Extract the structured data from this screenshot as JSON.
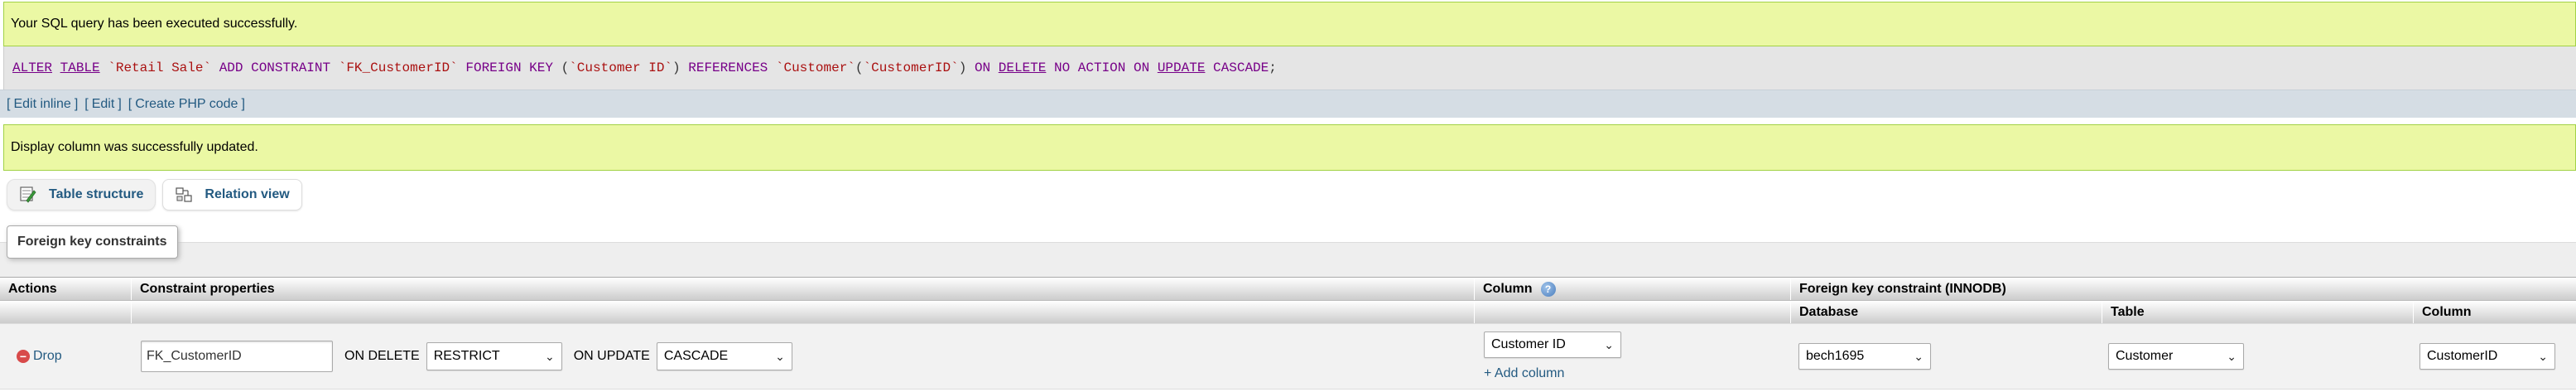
{
  "messages": {
    "query_success": "Your SQL query has been executed successfully.",
    "display_updated": "Display column was successfully updated."
  },
  "sql": {
    "tokens": [
      {
        "t": "ALTER",
        "c": "kw-u"
      },
      {
        "t": " ",
        "c": ""
      },
      {
        "t": "TABLE",
        "c": "kw-u"
      },
      {
        "t": " ",
        "c": ""
      },
      {
        "t": "`Retail Sale`",
        "c": "str"
      },
      {
        "t": " ",
        "c": ""
      },
      {
        "t": "ADD CONSTRAINT",
        "c": "kw"
      },
      {
        "t": " ",
        "c": ""
      },
      {
        "t": "`FK_CustomerID`",
        "c": "str"
      },
      {
        "t": " ",
        "c": ""
      },
      {
        "t": "FOREIGN KEY",
        "c": "kw"
      },
      {
        "t": " ",
        "c": ""
      },
      {
        "t": "(",
        "c": "punc"
      },
      {
        "t": "`Customer ID`",
        "c": "str"
      },
      {
        "t": ")",
        "c": "punc"
      },
      {
        "t": " ",
        "c": ""
      },
      {
        "t": "REFERENCES",
        "c": "kw"
      },
      {
        "t": " ",
        "c": ""
      },
      {
        "t": "`Customer`",
        "c": "str"
      },
      {
        "t": "(",
        "c": "punc"
      },
      {
        "t": "`CustomerID`",
        "c": "str"
      },
      {
        "t": ")",
        "c": "punc"
      },
      {
        "t": " ",
        "c": ""
      },
      {
        "t": "ON",
        "c": "kw"
      },
      {
        "t": " ",
        "c": ""
      },
      {
        "t": "DELETE",
        "c": "kw-u"
      },
      {
        "t": " ",
        "c": ""
      },
      {
        "t": "NO ACTION",
        "c": "kw"
      },
      {
        "t": " ",
        "c": ""
      },
      {
        "t": "ON",
        "c": "kw"
      },
      {
        "t": " ",
        "c": ""
      },
      {
        "t": "UPDATE",
        "c": "kw-u"
      },
      {
        "t": " ",
        "c": ""
      },
      {
        "t": "CASCADE",
        "c": "kw"
      },
      {
        "t": ";",
        "c": "punc"
      }
    ]
  },
  "links": {
    "edit_inline": "Edit inline",
    "edit": "Edit",
    "create_php": "Create PHP code",
    "open_bracket": "[",
    "close_bracket": "]"
  },
  "tabs": {
    "structure": "Table structure",
    "relation": "Relation view"
  },
  "fieldset": {
    "legend": "Foreign key constraints"
  },
  "table": {
    "headers": {
      "actions": "Actions",
      "constraint_props": "Constraint properties",
      "column": "Column",
      "fk_constraint": "Foreign key constraint (INNODB)",
      "database": "Database",
      "table": "Table",
      "ref_column": "Column"
    },
    "row": {
      "drop": "Drop",
      "constraint_name": "FK_CustomerID",
      "on_delete_label": "ON DELETE",
      "on_delete_value": "RESTRICT",
      "on_update_label": "ON UPDATE",
      "on_update_value": "CASCADE",
      "column_value": "Customer ID",
      "add_column": "+ Add column",
      "database_value": "bech1695",
      "table_value": "Customer",
      "ref_column_value": "CustomerID"
    }
  },
  "colors": {
    "success_bg": "#ebf8a4",
    "link": "#235a81",
    "sql_keyword": "#770088",
    "sql_string": "#aa1111"
  }
}
